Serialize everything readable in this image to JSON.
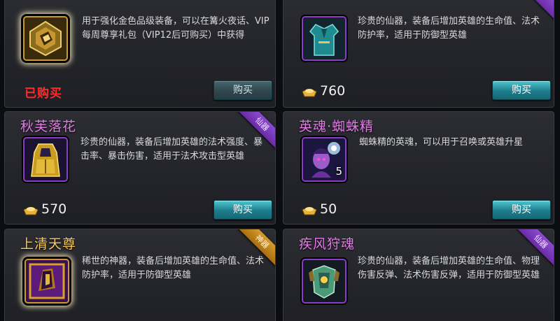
{
  "cards": [
    {
      "title": "",
      "desc": "用于强化金色品级装备，可以在篝火夜话、VIP每周尊享礼包（VIP12后可购买）中获得",
      "status": "已购买",
      "buy_label": "购买",
      "icon": "gold-equipment-upgrade-box-icon"
    },
    {
      "title": "",
      "desc": "珍贵的仙器，装备后增加英雄的生命值、法术防护率，适用于防御型英雄",
      "price": "760",
      "buy_label": "购买",
      "icon": "jade-robe-icon",
      "ribbon": ""
    },
    {
      "title": "秋芙落花",
      "desc": "珍贵的仙器，装备后增加英雄的法术强度、暴击率、暴击伤害，适用于法术攻击型英雄",
      "price": "570",
      "buy_label": "购买",
      "icon": "golden-cloak-icon",
      "ribbon": "仙器"
    },
    {
      "title": "英魂·蜘蛛精",
      "desc": "蜘蛛精的英魂，可以用于召唤或英雄升星",
      "price": "50",
      "buy_label": "购买",
      "icon": "spider-spirit-portrait-icon",
      "count": "5"
    },
    {
      "title": "上清天尊",
      "desc": "稀世的神器，装备后增加英雄的生命值、法术防护率，适用于防御型英雄",
      "icon": "divine-artifact-icon",
      "ribbon": "神器"
    },
    {
      "title": "疾风狩魂",
      "desc": "珍贵的仙器，装备后增加英雄的生命值、物理伤害反弹、法术伤害反弹，适用于防御型英雄",
      "icon": "green-armor-icon",
      "ribbon": "仙器"
    }
  ],
  "colors": {
    "title_purple": "#e37ae6",
    "title_gold": "#f5c95a",
    "sold_red": "#ff2b2b",
    "buy_teal": "#1d7d8d"
  }
}
